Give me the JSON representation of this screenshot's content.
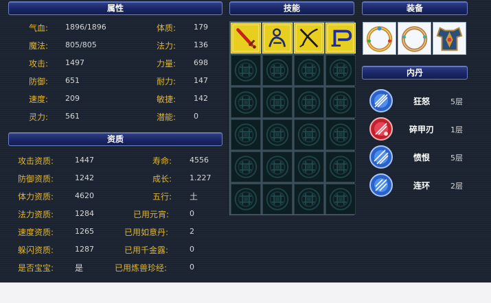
{
  "attributes": {
    "title": "属性",
    "rows": [
      {
        "label1": "气血:",
        "value1": "1896/1896",
        "label2": "体质:",
        "value2": "179"
      },
      {
        "label1": "魔法:",
        "value1": "805/805",
        "label2": "法力:",
        "value2": "136"
      },
      {
        "label1": "攻击:",
        "value1": "1497",
        "label2": "力量:",
        "value2": "698"
      },
      {
        "label1": "防御:",
        "value1": "651",
        "label2": "耐力:",
        "value2": "147"
      },
      {
        "label1": "速度:",
        "value1": "209",
        "label2": "敏捷:",
        "value2": "142"
      },
      {
        "label1": "灵力:",
        "value1": "561",
        "label2": "潜能:",
        "value2": "0"
      }
    ]
  },
  "aptitude": {
    "title": "资质",
    "rows": [
      {
        "label1": "攻击资质:",
        "value1": "1447",
        "label2": "寿命:",
        "value2": "4556"
      },
      {
        "label1": "防御资质:",
        "value1": "1242",
        "label2": "成长:",
        "value2": "1.227"
      },
      {
        "label1": "体力资质:",
        "value1": "4620",
        "label2": "五行:",
        "value2": "土"
      },
      {
        "label1": "法力资质:",
        "value1": "1284",
        "label2": "已用元宵:",
        "value2": "0"
      },
      {
        "label1": "速度资质:",
        "value1": "1265",
        "label2": "已用如意丹:",
        "value2": "2"
      },
      {
        "label1": "躲闪资质:",
        "value1": "1287",
        "label2": "已用千金露:",
        "value2": "0"
      },
      {
        "label1": "是否宝宝:",
        "value1": "是",
        "label2": "已用炼兽珍经:",
        "value2": "0"
      }
    ]
  },
  "skills": {
    "title": "技能",
    "icons": [
      "sword-skill-icon",
      "horse-rider-skill-icon",
      "crossed-blades-skill-icon",
      "bow-skill-icon"
    ],
    "empty_slot_icon": "empty-skill-slot-icon"
  },
  "equipment": {
    "title": "装备",
    "icons": [
      "gold-ring-icon",
      "silver-ring-icon",
      "armor-icon"
    ]
  },
  "inner_pill": {
    "title": "内丹",
    "items": [
      {
        "name": "狂怒",
        "level": "5层",
        "icon": "blue-orb-icon",
        "color": "#3a7fe0"
      },
      {
        "name": "碎甲刃",
        "level": "1层",
        "icon": "red-orb-icon",
        "color": "#d6293a"
      },
      {
        "name": "愤恨",
        "level": "5层",
        "icon": "blue-orb-icon",
        "color": "#3a7fe0"
      },
      {
        "name": "连环",
        "level": "2层",
        "icon": "blue-orb-icon",
        "color": "#3a7fe0"
      }
    ]
  },
  "colors": {
    "background": "#1b2330",
    "label": "#e1b52d",
    "value": "#d8d8d8",
    "header": "#1a2766"
  }
}
